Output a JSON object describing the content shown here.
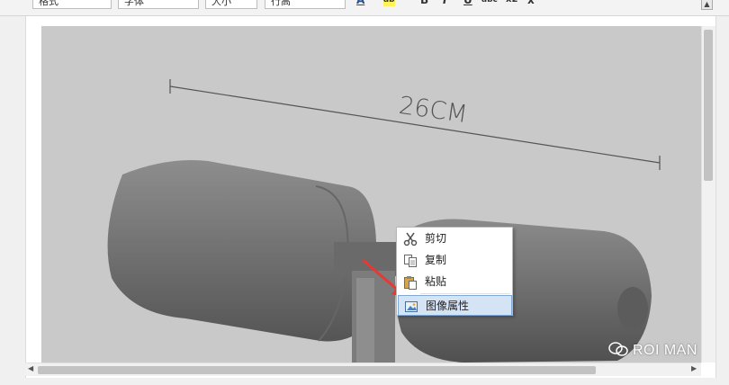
{
  "toolbar": {
    "style_combo": "格式",
    "font_combo": "字体",
    "size_combo": "大小",
    "line_height_combo": "行高",
    "buttons": [
      "A",
      "ab",
      "B",
      "I",
      "U",
      "abc",
      "x2",
      "x"
    ]
  },
  "image": {
    "dimension_label": "26CM",
    "watermark_text": "ROI MAN"
  },
  "context_menu": {
    "items": [
      {
        "label": "剪切",
        "icon": "scissors-icon"
      },
      {
        "label": "复制",
        "icon": "copy-icon"
      },
      {
        "label": "粘贴",
        "icon": "paste-icon"
      },
      {
        "label": "图像属性",
        "icon": "image-icon",
        "highlighted": true
      }
    ]
  },
  "colors": {
    "menu_highlight": "#d5e4f5",
    "menu_highlight_border": "#7fa9d9",
    "arrow": "#e53935"
  }
}
